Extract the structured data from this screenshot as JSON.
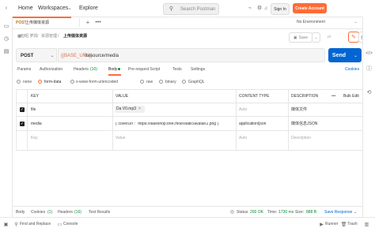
{
  "topbar": {
    "home": "Home",
    "workspaces": "Workspaces",
    "explore": "Explore",
    "search_placeholder": "Search Postman",
    "sign_in": "Sign In",
    "create_account": "Create Account"
  },
  "tabbar": {
    "tab_method": "POST",
    "tab_title": "上传媒体资源",
    "environment": "No Environment"
  },
  "breadcrumb": {
    "part1": "旭昭 罗凯",
    "sep1": "/",
    "part2": "资源管理",
    "sep2": "/",
    "current": "上传媒体资源"
  },
  "actions": {
    "save": "Save"
  },
  "request": {
    "method": "POST",
    "url_var": "{{BASE_URL}}",
    "url_path": "/resource/media",
    "send": "Send"
  },
  "req_tabs": {
    "params": "Params",
    "authorization": "Authorization",
    "headers": "Headers",
    "headers_count": "(10)",
    "body": "Body",
    "prerequest": "Pre-request Script",
    "tests": "Tests",
    "settings": "Settings",
    "cookies": "Cookies"
  },
  "body_types": [
    "none",
    "form-data",
    "x-www-form-urlencoded",
    "raw",
    "binary",
    "GraphQL"
  ],
  "body_selected": "form-data",
  "table": {
    "headers": {
      "key": "KEY",
      "value": "VALUE",
      "content_type": "CONTENT TYPE",
      "description": "DESCRIPTION",
      "more": "•••",
      "bulk_edit": "Bulk Edit"
    },
    "rows": [
      {
        "key": "file",
        "value": "Da V0.mp3",
        "content_type": "Auto",
        "description": "媒体文件"
      },
      {
        "key": "media",
        "value": "{\"coverUrl\": \"https://fakeshop.tree.moe/static/avatar/2.png\"}",
        "content_type": "application/json",
        "description": "媒体信息JSON"
      }
    ],
    "placeholder": {
      "key": "Key",
      "value": "Value",
      "content_type": "Auto",
      "description": "Description"
    }
  },
  "response_bar": {
    "body": "Body",
    "cookies": "Cookies",
    "cookies_count": "(1)",
    "headers": "Headers",
    "headers_count": "(16)",
    "test_results": "Test Results",
    "status_label": "Status:",
    "status": "200 OK",
    "time_label": "Time:",
    "time": "1730 ms",
    "size_label": "Size:",
    "size": "888 B",
    "save_response": "Save Response"
  },
  "bottombar": {
    "find_replace": "Find and Replace",
    "console": "Console",
    "runner": "Runner",
    "trash": "Trash"
  },
  "colors": {
    "accent": "#ff6c37",
    "send": "#0265d2",
    "status_ok": "#0a8a3a",
    "url_var": "#e06c4a",
    "method_post": "#b7791f"
  }
}
